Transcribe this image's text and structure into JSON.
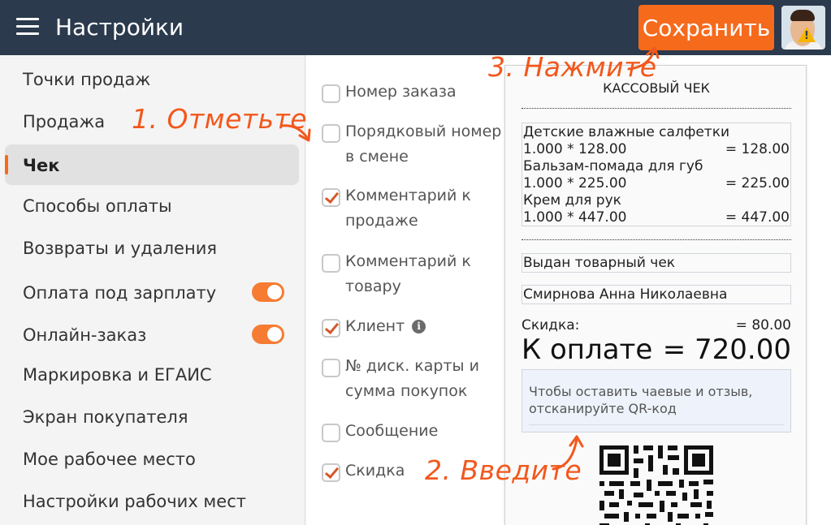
{
  "header": {
    "title": "Настройки",
    "save_label": "Сохранить"
  },
  "sidebar": {
    "items": [
      {
        "label": "Точки продаж"
      },
      {
        "label": "Продажа"
      },
      {
        "label": "Чек"
      },
      {
        "label": "Способы оплаты"
      },
      {
        "label": "Возвраты и удаления"
      },
      {
        "label": "Оплата под зарплату",
        "toggle": "on"
      },
      {
        "label": "Онлайн-заказ",
        "toggle": "on"
      },
      {
        "label": "Маркировка и ЕГАИС"
      },
      {
        "label": "Экран покупателя"
      },
      {
        "label": "Мое рабочее место"
      },
      {
        "label": "Настройки рабочих мест"
      }
    ],
    "active_index": 2
  },
  "options": [
    {
      "label": "Номер заказа",
      "checked": false
    },
    {
      "label": "Порядковый номер в смене",
      "checked": false
    },
    {
      "label": "Комментарий к продаже",
      "checked": true
    },
    {
      "label": "Комментарий к товару",
      "checked": false
    },
    {
      "label": "Клиент",
      "checked": true
    },
    {
      "label": "№ диск. карты и сумма покупок",
      "checked": false
    },
    {
      "label": "Сообщение",
      "checked": false
    },
    {
      "label": "Скидка",
      "checked": true
    }
  ],
  "receipt": {
    "title": "КАССОВЫЙ ЧЕК",
    "items": [
      {
        "name": "Детские влажные салфетки",
        "calc": "1.000 * 128.00",
        "sum": "= 128.00"
      },
      {
        "name": "Бальзам-помада для губ",
        "calc": "1.000 * 225.00",
        "sum": "= 225.00"
      },
      {
        "name": "Крем для рук",
        "calc": "1.000 * 447.00",
        "sum": "= 447.00"
      }
    ],
    "comment": "Выдан товарный чек",
    "client": "Смирнова Анна Николаевна",
    "discount_label": "Скидка:",
    "discount_value": "= 80.00",
    "total_label": "К оплате",
    "total_value": "= 720.00",
    "tips_line1": "Чтобы оставить чаевые и отзыв,",
    "tips_line2": "отсканируйте QR-код"
  },
  "annotations": {
    "step1": "1. Отметьте",
    "step2": "2. Введите",
    "step3": "3. Нажмите",
    "color": "#f2581d"
  },
  "colors": {
    "header_bg": "#2b3a4d",
    "accent": "#f66a1c"
  }
}
